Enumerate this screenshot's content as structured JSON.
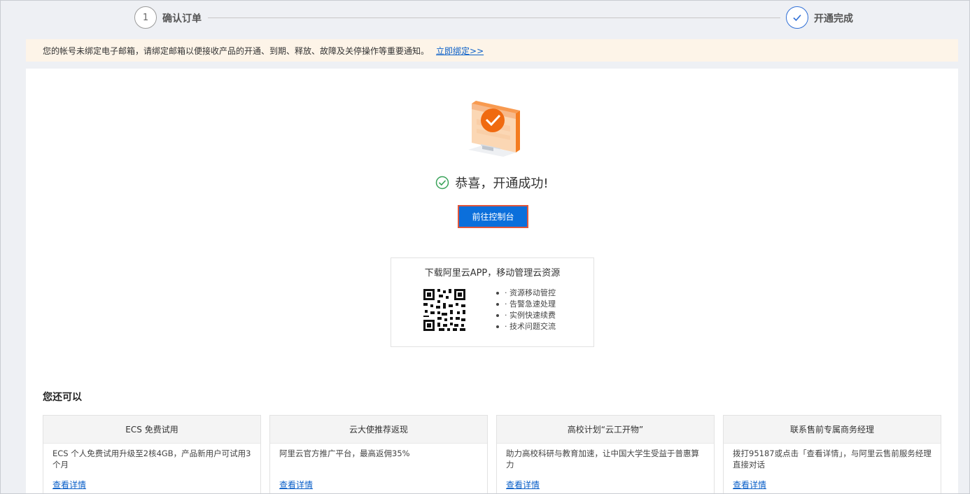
{
  "steps": [
    {
      "number": "1",
      "label": "确认订单"
    },
    {
      "label": "开通完成"
    }
  ],
  "notice": {
    "text": "您的帐号未绑定电子邮箱，请绑定邮箱以便接收产品的开通、到期、释放、故障及关停操作等重要通知。",
    "link": "立即绑定>>"
  },
  "success": {
    "message": "恭喜，开通成功!",
    "button": "前往控制台"
  },
  "app": {
    "title": "下载阿里云APP，移动管理云资源",
    "features": [
      "· 资源移动管控",
      "· 告警急速处理",
      "· 实例快速续费",
      "· 技术问题交流"
    ]
  },
  "also": {
    "title": "您还可以",
    "cards": [
      {
        "title": "ECS 免费试用",
        "desc": "ECS 个人免费试用升级至2核4GB，产品新用户可试用3个月",
        "link": "查看详情"
      },
      {
        "title": "云大使推荐返现",
        "desc": "阿里云官方推广平台，最高返佣35%",
        "link": "查看详情"
      },
      {
        "title": "高校计划“云工开物”",
        "desc": "助力高校科研与教育加速，让中国大学生受益于普惠算力",
        "link": "查看详情"
      },
      {
        "title": "联系售前专属商务经理",
        "desc": "拨打95187或点击「查看详情」，与阿里云售前服务经理直接对话",
        "link": "查看详情"
      }
    ]
  },
  "colors": {
    "accent": "#0b6fdb",
    "link": "#0a5fc8",
    "success": "#3aa35a",
    "notice_bg": "#fdf4e8",
    "illustration": "#f47c20"
  }
}
